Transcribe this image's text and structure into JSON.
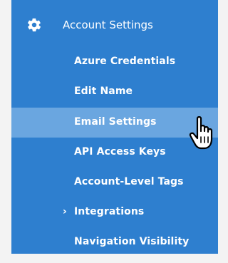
{
  "menu": {
    "header": {
      "title": "Account Settings",
      "icon": "gear-icon"
    },
    "items": [
      {
        "label": "Azure Credentials",
        "active": false
      },
      {
        "label": "Edit Name",
        "active": false
      },
      {
        "label": "Email Settings",
        "active": true
      },
      {
        "label": "API Access Keys",
        "active": false
      },
      {
        "label": "Account-Level Tags",
        "active": false
      },
      {
        "label": "Integrations",
        "active": false,
        "expandable": true,
        "chevron": "›"
      },
      {
        "label": "Navigation Visibility",
        "active": false
      }
    ]
  },
  "colors": {
    "menu_bg": "#2e7fcf",
    "active_bg": "#6aa6e0",
    "page_bg": "#f3f3f3",
    "text": "#ffffff"
  },
  "cursor": {
    "icon": "hand-pointer-icon"
  }
}
